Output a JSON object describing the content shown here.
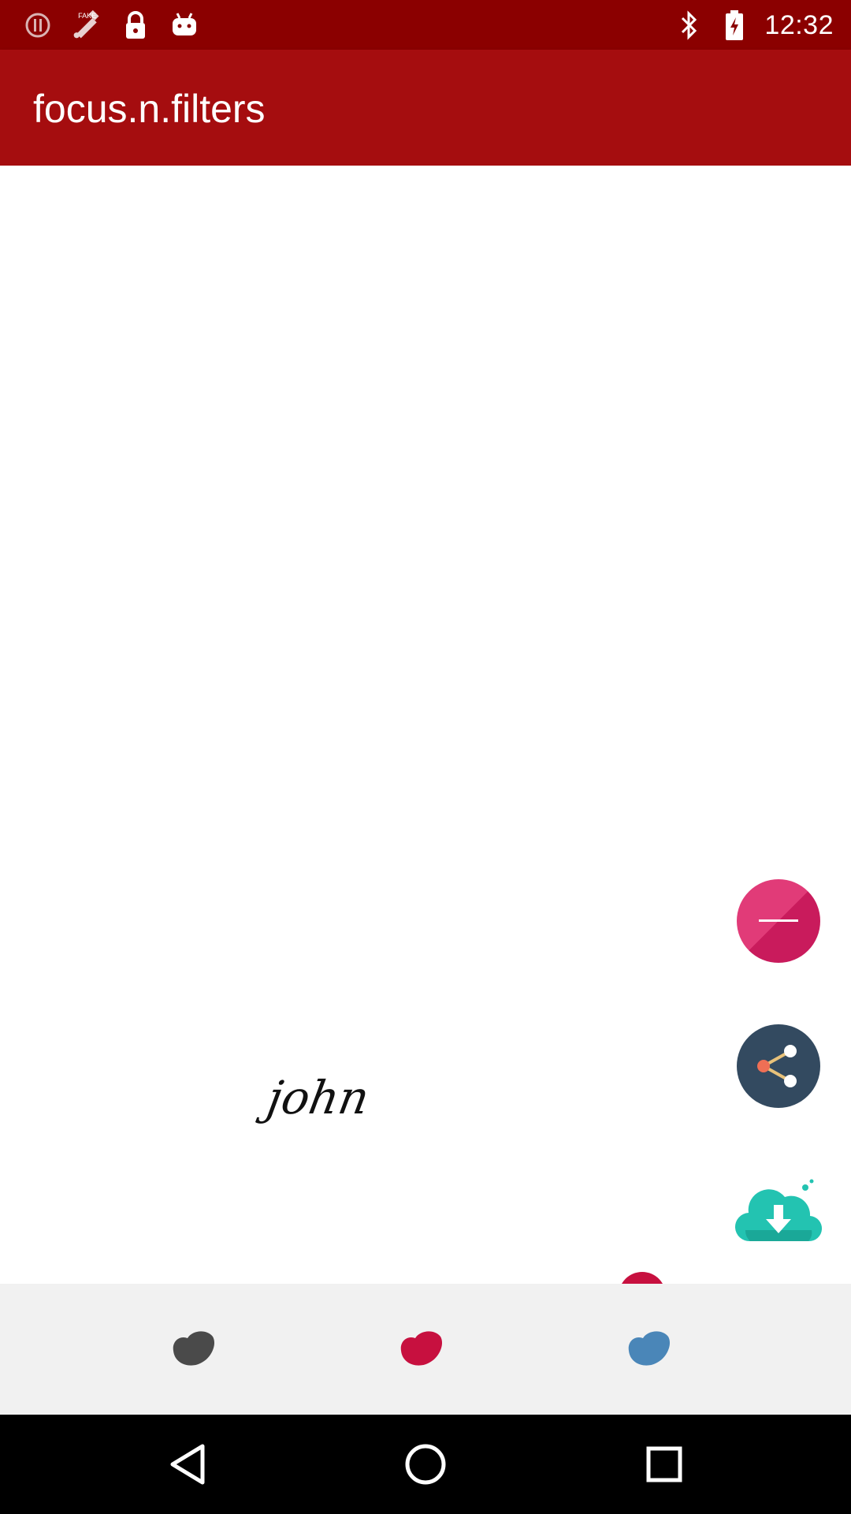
{
  "status_bar": {
    "time": "12:32",
    "left_icons": [
      "alert-icon",
      "fake-gps-icon",
      "lock-icon",
      "android-icon"
    ],
    "right_icons": [
      "bluetooth-icon",
      "battery-charging-icon"
    ]
  },
  "app_bar": {
    "title": "focus.n.filters"
  },
  "canvas": {
    "signature_text": "john"
  },
  "actions": {
    "minus_icon": "minus-icon",
    "share_icon": "share-icon",
    "download_icon": "cloud-download-icon"
  },
  "colors": {
    "status_bar": "#8b0000",
    "app_bar": "#a50d0f",
    "swatch_dark": "#4a4a4a",
    "swatch_red": "#c7103f",
    "swatch_blue": "#4a86b8",
    "fab_pink": "#e13b78",
    "fab_share": "#334a60",
    "cloud_teal": "#23c3b1"
  },
  "nav_bar": {
    "buttons": [
      "back-icon",
      "home-icon",
      "recent-apps-icon"
    ]
  }
}
